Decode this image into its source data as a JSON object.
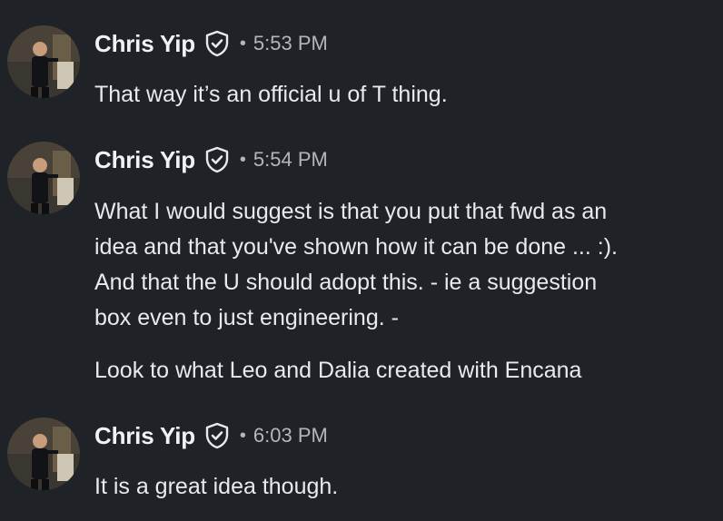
{
  "messages": [
    {
      "author": "Chris Yip",
      "separator": "•",
      "time": "5:53 PM",
      "paragraphs": [
        "That way it’s an official u of T thing."
      ]
    },
    {
      "author": "Chris Yip",
      "separator": "•",
      "time": "5:54 PM",
      "paragraphs": [
        "What I would suggest is that you put that fwd as an",
        "idea and that you've shown how it can be done ... :).",
        "And that the U should adopt this. - ie a suggestion",
        "box even to just engineering. -",
        "Look to what Leo and Dalia created with Encana"
      ]
    },
    {
      "author": "Chris Yip",
      "separator": "•",
      "time": "6:03 PM",
      "paragraphs": [
        "It is a great idea though."
      ]
    }
  ],
  "colors": {
    "background": "#1f2227",
    "text": "#e9eaec",
    "muted": "#b4b6ba"
  },
  "icons": {
    "verified": "verified-badge-icon",
    "avatar": "avatar-photo"
  }
}
